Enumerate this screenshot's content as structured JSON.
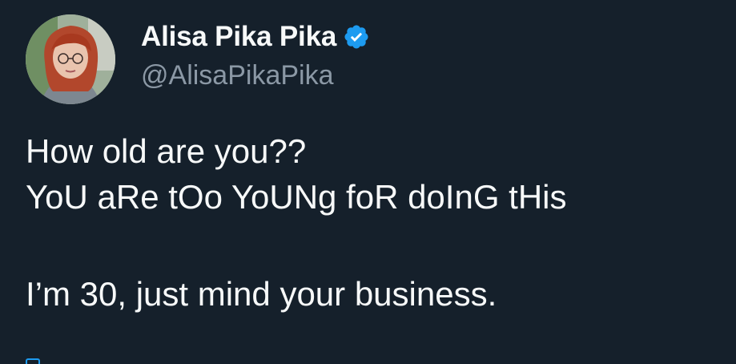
{
  "author": {
    "display_name": "Alisa Pika Pika",
    "handle": "@AlisaPikaPika",
    "verified": true,
    "verified_icon": "verified-badge-icon",
    "verified_color": "#1d9bf0"
  },
  "tweet": {
    "lines": [
      "How old are you??",
      "YoU aRe tOo YoUNg foR doInG tHis",
      "",
      "I’m 30, just mind your business."
    ]
  },
  "theme": {
    "background": "#15202b",
    "text": "#f7f9f9",
    "secondary_text": "#8b98a5",
    "accent": "#1d9bf0"
  }
}
